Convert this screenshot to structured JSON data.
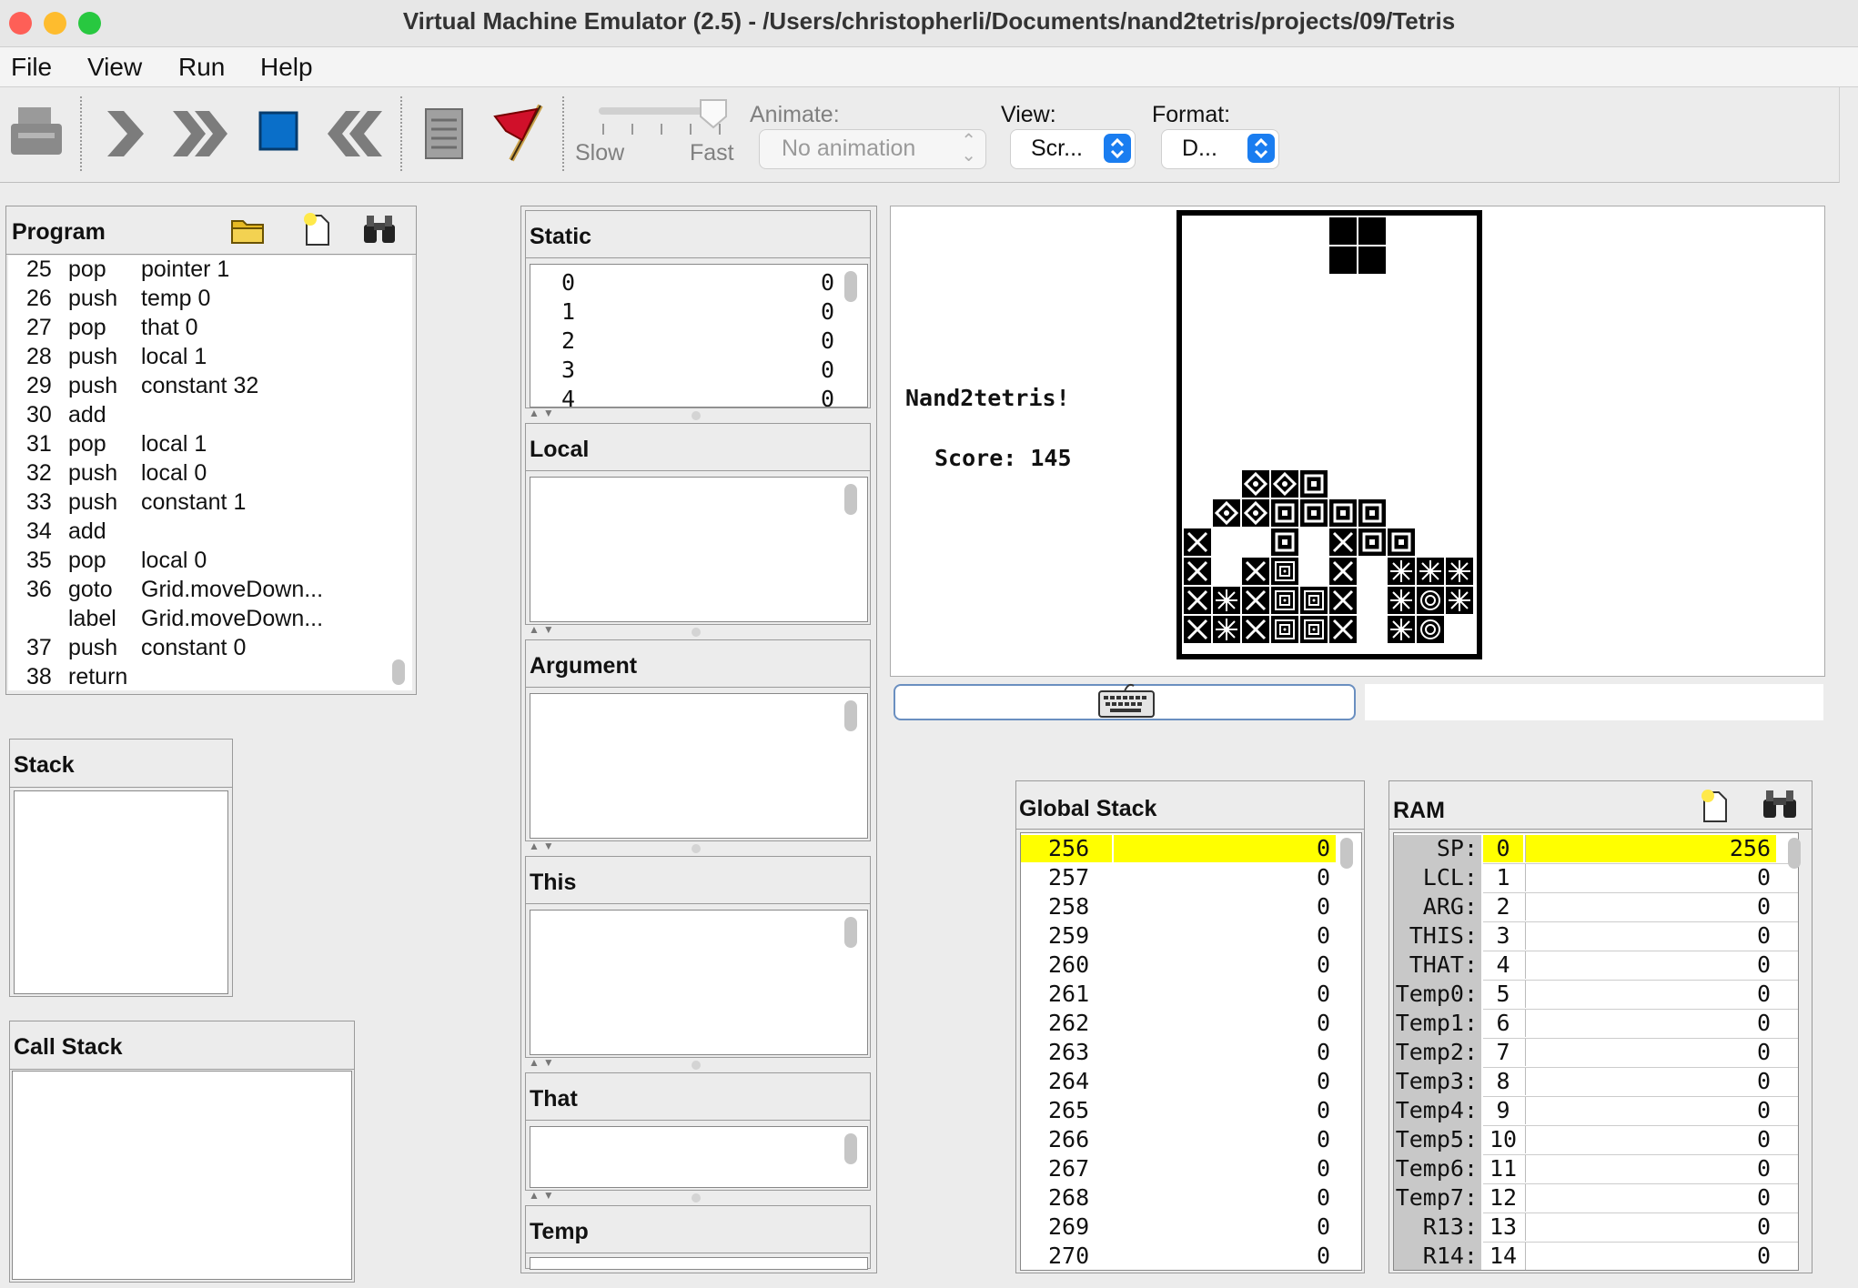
{
  "window": {
    "title": "Virtual Machine Emulator (2.5) - /Users/christopherli/Documents/nand2tetris/projects/09/Tetris"
  },
  "menu": {
    "file": "File",
    "view": "View",
    "run": "Run",
    "help": "Help"
  },
  "toolbar": {
    "speed_slow": "Slow",
    "speed_fast": "Fast",
    "animate_label": "Animate:",
    "animate_value": "No animation",
    "view_label": "View:",
    "view_value": "Scr...",
    "format_label": "Format:",
    "format_value": "D..."
  },
  "program": {
    "title": "Program",
    "rows": [
      {
        "n": "25",
        "cmd": "pop",
        "arg": "pointer 1"
      },
      {
        "n": "26",
        "cmd": "push",
        "arg": "temp 0"
      },
      {
        "n": "27",
        "cmd": "pop",
        "arg": "that 0"
      },
      {
        "n": "28",
        "cmd": "push",
        "arg": "local 1"
      },
      {
        "n": "29",
        "cmd": "push",
        "arg": "constant 32"
      },
      {
        "n": "30",
        "cmd": "add",
        "arg": ""
      },
      {
        "n": "31",
        "cmd": "pop",
        "arg": "local 1"
      },
      {
        "n": "32",
        "cmd": "push",
        "arg": "local 0"
      },
      {
        "n": "33",
        "cmd": "push",
        "arg": "constant 1"
      },
      {
        "n": "34",
        "cmd": "add",
        "arg": ""
      },
      {
        "n": "35",
        "cmd": "pop",
        "arg": "local 0"
      },
      {
        "n": "36",
        "cmd": "goto",
        "arg": "Grid.moveDown..."
      },
      {
        "n": "",
        "cmd": "label",
        "arg": "Grid.moveDown..."
      },
      {
        "n": "37",
        "cmd": "push",
        "arg": "constant 0"
      },
      {
        "n": "38",
        "cmd": "return",
        "arg": ""
      }
    ]
  },
  "stack": {
    "title": "Stack"
  },
  "call_stack": {
    "title": "Call Stack"
  },
  "segments": {
    "static": {
      "title": "Static",
      "rows": [
        {
          "i": "0",
          "v": "0"
        },
        {
          "i": "1",
          "v": "0"
        },
        {
          "i": "2",
          "v": "0"
        },
        {
          "i": "3",
          "v": "0"
        },
        {
          "i": "4",
          "v": "0"
        }
      ]
    },
    "local": {
      "title": "Local"
    },
    "argument": {
      "title": "Argument"
    },
    "this": {
      "title": "This"
    },
    "that": {
      "title": "That"
    },
    "temp": {
      "title": "Temp"
    }
  },
  "screen": {
    "game_title": "Nand2tetris!",
    "score_text": "Score: 145"
  },
  "global_stack": {
    "title": "Global Stack",
    "rows": [
      {
        "addr": "256",
        "v": "0"
      },
      {
        "addr": "257",
        "v": "0"
      },
      {
        "addr": "258",
        "v": "0"
      },
      {
        "addr": "259",
        "v": "0"
      },
      {
        "addr": "260",
        "v": "0"
      },
      {
        "addr": "261",
        "v": "0"
      },
      {
        "addr": "262",
        "v": "0"
      },
      {
        "addr": "263",
        "v": "0"
      },
      {
        "addr": "264",
        "v": "0"
      },
      {
        "addr": "265",
        "v": "0"
      },
      {
        "addr": "266",
        "v": "0"
      },
      {
        "addr": "267",
        "v": "0"
      },
      {
        "addr": "268",
        "v": "0"
      },
      {
        "addr": "269",
        "v": "0"
      },
      {
        "addr": "270",
        "v": "0"
      }
    ]
  },
  "ram": {
    "title": "RAM",
    "rows": [
      {
        "label": "SP:",
        "addr": "0",
        "v": "256"
      },
      {
        "label": "LCL:",
        "addr": "1",
        "v": "0"
      },
      {
        "label": "ARG:",
        "addr": "2",
        "v": "0"
      },
      {
        "label": "THIS:",
        "addr": "3",
        "v": "0"
      },
      {
        "label": "THAT:",
        "addr": "4",
        "v": "0"
      },
      {
        "label": "Temp0:",
        "addr": "5",
        "v": "0"
      },
      {
        "label": "Temp1:",
        "addr": "6",
        "v": "0"
      },
      {
        "label": "Temp2:",
        "addr": "7",
        "v": "0"
      },
      {
        "label": "Temp3:",
        "addr": "8",
        "v": "0"
      },
      {
        "label": "Temp4:",
        "addr": "9",
        "v": "0"
      },
      {
        "label": "Temp5:",
        "addr": "10",
        "v": "0"
      },
      {
        "label": "Temp6:",
        "addr": "11",
        "v": "0"
      },
      {
        "label": "Temp7:",
        "addr": "12",
        "v": "0"
      },
      {
        "label": "R13:",
        "addr": "13",
        "v": "0"
      },
      {
        "label": "R14:",
        "addr": "14",
        "v": "0"
      }
    ]
  },
  "colors": {
    "highlight": "#ffff00",
    "accent": "#1a7df0",
    "stop": "#0a6fc9",
    "flag": "#d0102a"
  }
}
